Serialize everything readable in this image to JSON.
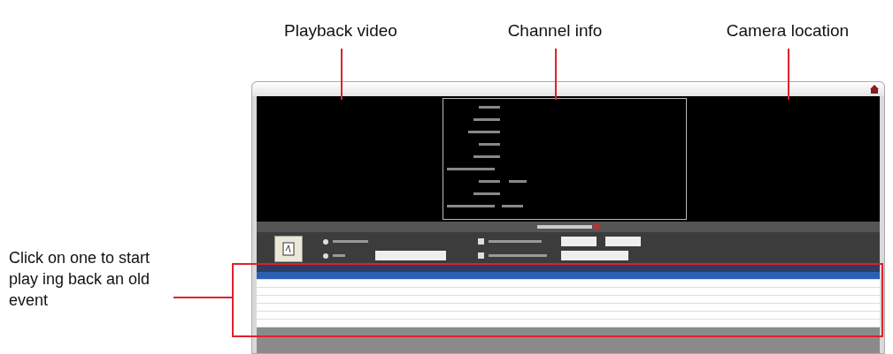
{
  "annotations": [
    {
      "label": "Playback video"
    },
    {
      "label": "Channel info"
    },
    {
      "label": "Camera location"
    }
  ],
  "callout": {
    "text": "Click on one to start play ing back an old event"
  },
  "table": {
    "rows": [
      {
        "selected": true
      },
      {
        "selected": false
      },
      {
        "selected": false
      },
      {
        "selected": false
      },
      {
        "selected": false
      },
      {
        "selected": false
      },
      {
        "selected": false
      }
    ]
  }
}
